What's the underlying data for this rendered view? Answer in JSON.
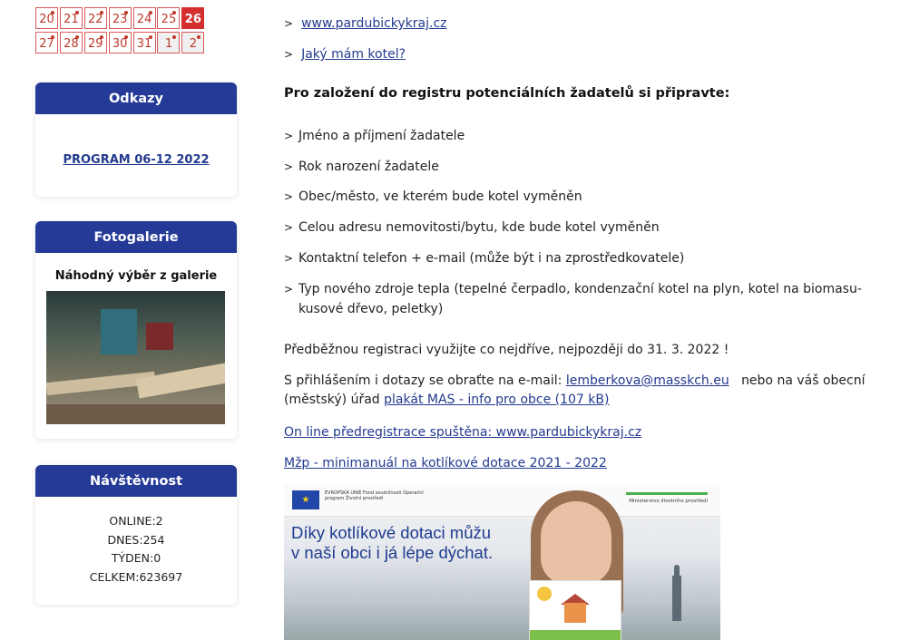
{
  "calendar": {
    "rows": [
      [
        {
          "day": "20",
          "state": "normal"
        },
        {
          "day": "21",
          "state": "normal"
        },
        {
          "day": "22",
          "state": "normal"
        },
        {
          "day": "23",
          "state": "normal"
        },
        {
          "day": "24",
          "state": "normal"
        },
        {
          "day": "25",
          "state": "normal"
        },
        {
          "day": "26",
          "state": "today"
        }
      ],
      [
        {
          "day": "27",
          "state": "normal"
        },
        {
          "day": "28",
          "state": "normal"
        },
        {
          "day": "29",
          "state": "normal"
        },
        {
          "day": "30",
          "state": "normal"
        },
        {
          "day": "31",
          "state": "normal"
        },
        {
          "day": "1",
          "state": "other"
        },
        {
          "day": "2",
          "state": "other"
        }
      ]
    ],
    "accent_color": "#d32f2f"
  },
  "odkazy": {
    "title": "Odkazy",
    "link": "PROGRAM 06-12 2022"
  },
  "fotogalerie": {
    "title": "Fotogalerie",
    "subtitle": "Náhodný výběr z galerie"
  },
  "navstevnost": {
    "title": "Návštěvnost",
    "online": "ONLINE:2",
    "dnes": "DNES:254",
    "tyden": "TÝDEN:0",
    "celkem": "CELKEM:623697"
  },
  "main": {
    "top_links": [
      "www.pardubickykraj.cz",
      "Jaký mám kotel?"
    ],
    "heading": "Pro založení do registru potenciálních žadatelů si připravte:",
    "items": [
      "Jméno a příjmení žadatele",
      "Rok narození žadatele",
      "Obec/město, ve kterém bude kotel vyměněn",
      "Celou adresu nemovitosti/bytu, kde bude kotel vyměněn",
      "Kontaktní telefon + e-mail (může být i na zprostředkovatele)",
      "Typ nového zdroje tepla (tepelné čerpadlo, kondenzační kotel na plyn, kotel na biomasu-kusové dřevo, peletky)"
    ],
    "registration": "Předběžnou registraci využijte co nejdříve, nejpozději do 31. 3. 2022 !",
    "contact_text_1": "S přihlášením i dotazy se obraťte na e-mail:",
    "contact_email": "lemberkova@masskch.eu",
    "contact_text_2": "nebo na váš obecní (městský) úřad",
    "contact_pdf": "plakát MAS - info pro obce (107 kB)",
    "online_link": "On line předregistrace spuštěna: www.pardubickykraj.cz",
    "manual_link": "Mžp - minimanuál na kotlíkové dotace 2021 - 2022",
    "banner": {
      "eu_text": "EVROPSKÁ UNIE Fond soudržnosti Operační program Životní prostředí",
      "ministry": "Ministerstvo životního prostředí",
      "slogan_line1": "Díky kotlíkové dotaci můžu",
      "slogan_line2": "v naší obci i já lépe dýchat."
    }
  },
  "colors": {
    "header_blue": "#243a96",
    "link_blue": "#233a8f"
  }
}
